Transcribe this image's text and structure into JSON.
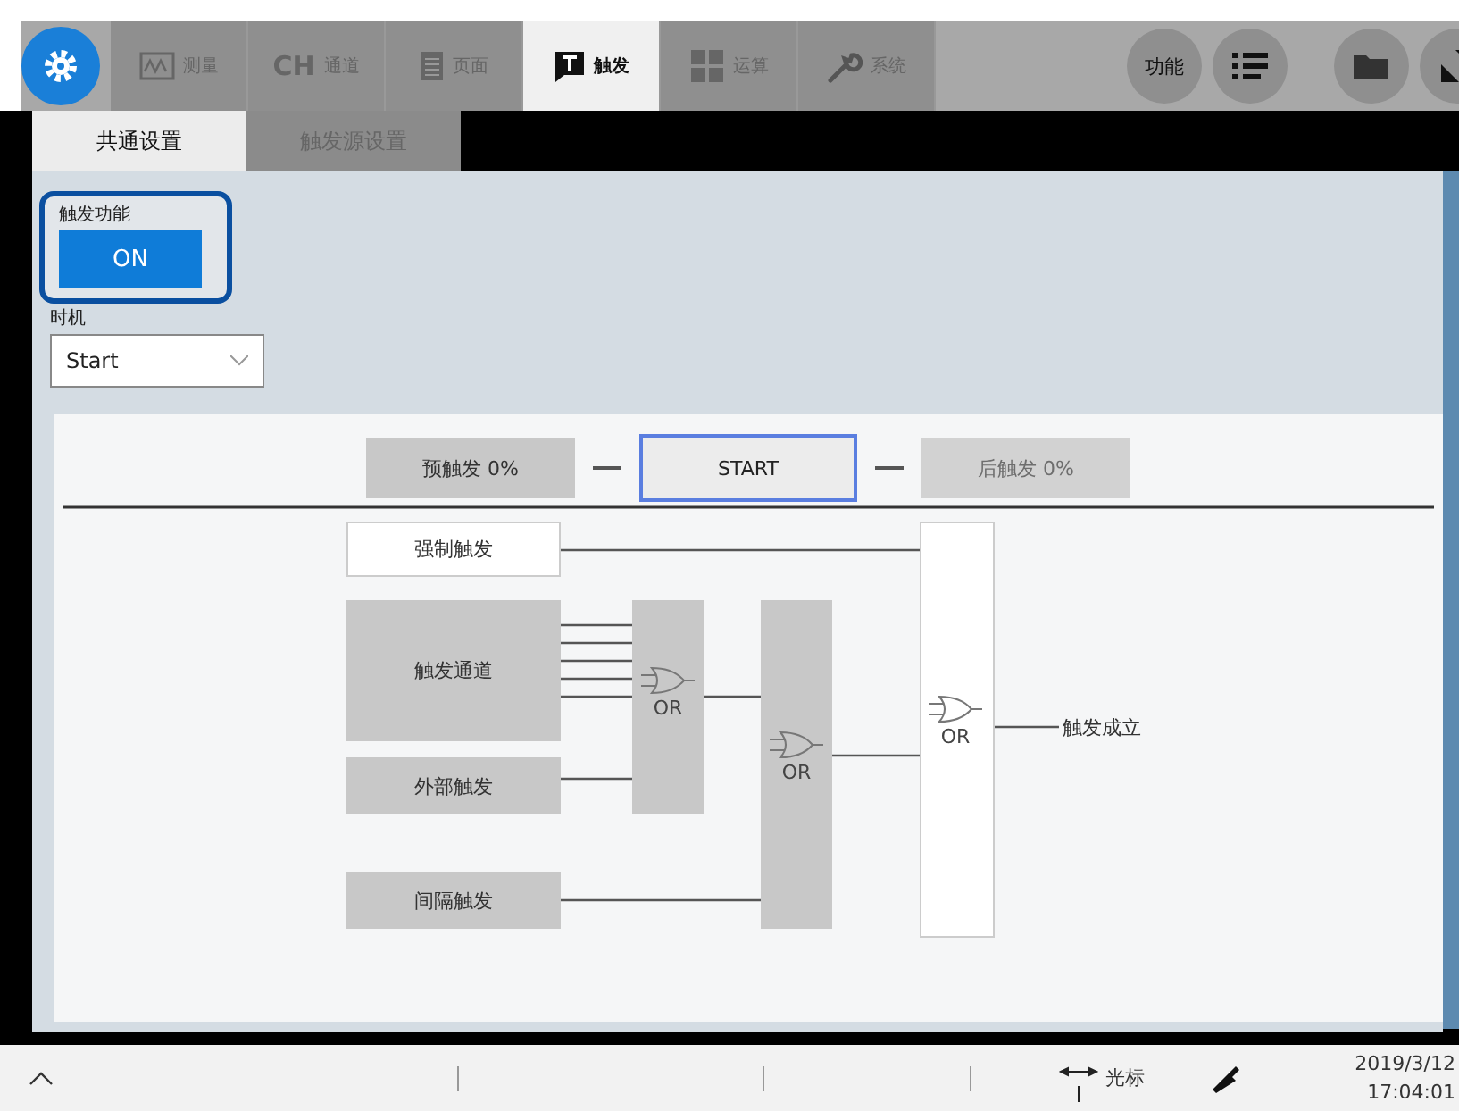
{
  "toolbar": {
    "tabs": [
      {
        "kind": "wave",
        "label": "测量",
        "selected": false
      },
      {
        "kind": "ch",
        "prefix": "CH",
        "label": "通道",
        "selected": false
      },
      {
        "kind": "page",
        "label": "页面",
        "selected": false
      },
      {
        "kind": "trigger",
        "label": "触发",
        "selected": true
      },
      {
        "kind": "calc",
        "label": "运算",
        "selected": false
      },
      {
        "kind": "wrench",
        "label": "系统",
        "selected": false
      }
    ],
    "function_button": "功能"
  },
  "subtabs": [
    {
      "label": "共通设置",
      "selected": true
    },
    {
      "label": "触发源设置",
      "selected": false
    }
  ],
  "trigger_function": {
    "label": "触发功能",
    "value": "ON",
    "on": true
  },
  "timing": {
    "label": "时机",
    "value": "Start"
  },
  "timeline": {
    "pre": {
      "label": "预触发 0%",
      "disabled": false
    },
    "start": "START",
    "post": {
      "label": "后触发 0%",
      "disabled": true
    }
  },
  "sources": [
    {
      "label": "强制触发",
      "kind": "plain"
    },
    {
      "label": "触发通道",
      "kind": "filled"
    },
    {
      "label": "外部触发",
      "kind": "filled"
    },
    {
      "label": "间隔触发",
      "kind": "filled"
    }
  ],
  "gates": [
    "OR",
    "OR",
    "OR"
  ],
  "output": "触发成立",
  "status_bar": {
    "cursor": "光标",
    "date": "2019/3/12",
    "time": "17:04:01"
  }
}
